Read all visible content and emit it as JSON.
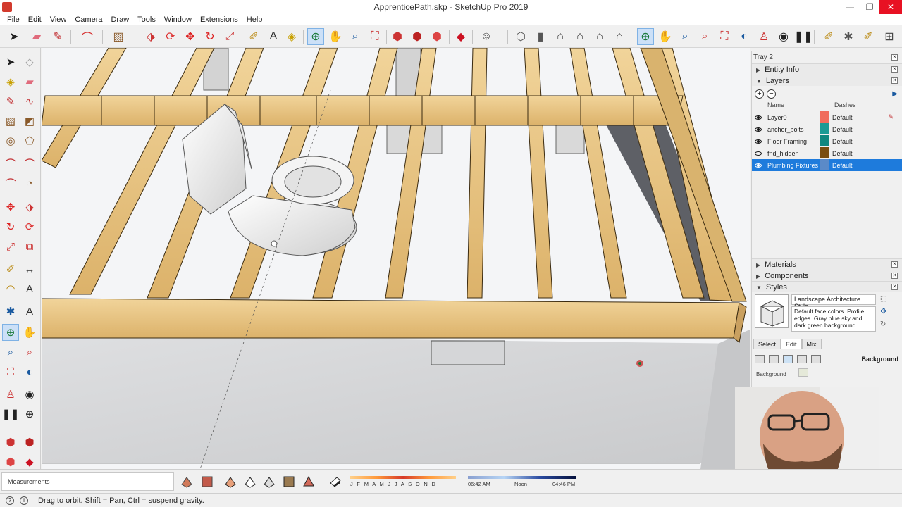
{
  "window": {
    "title": "ApprenticePath.skp - SketchUp Pro 2019",
    "controls": [
      "minimize",
      "maximize",
      "close"
    ]
  },
  "menu": [
    "File",
    "Edit",
    "View",
    "Camera",
    "Draw",
    "Tools",
    "Window",
    "Extensions",
    "Help"
  ],
  "toolbar": {
    "tools": [
      {
        "name": "select-icon",
        "glyph": "➤",
        "color": "#222222"
      },
      {
        "name": "eraser-icon",
        "glyph": "▰",
        "color": "#e06b7c"
      },
      {
        "name": "line-icon",
        "glyph": "✎",
        "color": "#c0282b"
      },
      {
        "name": "arc-icon",
        "glyph": "⌒",
        "color": "#d52a2a"
      },
      {
        "name": "rectangle-icon",
        "glyph": "▧",
        "color": "#8a5a2a"
      },
      {
        "name": "push-pull-icon",
        "glyph": "⬗",
        "color": "#c33"
      },
      {
        "name": "follow-me-icon",
        "glyph": "⟳",
        "color": "#d33"
      },
      {
        "name": "move-icon",
        "glyph": "✥",
        "color": "#d22"
      },
      {
        "name": "rotate-icon",
        "glyph": "↻",
        "color": "#d22"
      },
      {
        "name": "scale-icon",
        "glyph": "⤢",
        "color": "#c33"
      },
      {
        "name": "tape-measure-icon",
        "glyph": "✐",
        "color": "#b8860b"
      },
      {
        "name": "text-icon",
        "glyph": "A",
        "color": "#333"
      },
      {
        "name": "paint-bucket-icon",
        "glyph": "◈",
        "color": "#c8a000"
      },
      {
        "name": "orbit-icon",
        "glyph": "⊕",
        "color": "#1a7a3a",
        "active": true
      },
      {
        "name": "pan-icon",
        "glyph": "✋",
        "color": "#c8a060"
      },
      {
        "name": "zoom-icon",
        "glyph": "⌕",
        "color": "#1a5aa0"
      },
      {
        "name": "zoom-extents-icon",
        "glyph": "⛶",
        "color": "#c33"
      },
      {
        "name": "warehouse-icon",
        "glyph": "⬢",
        "color": "#c33"
      },
      {
        "name": "share-model-icon",
        "glyph": "⬢",
        "color": "#b22"
      },
      {
        "name": "extension-warehouse-icon",
        "glyph": "⬢",
        "color": "#d44"
      },
      {
        "name": "ruby-icon",
        "glyph": "◆",
        "color": "#c12"
      },
      {
        "name": "account-icon",
        "glyph": "☺",
        "color": "#444"
      },
      {
        "name": "iso-view-icon",
        "glyph": "⬡",
        "color": "#555"
      },
      {
        "name": "top-view-icon",
        "glyph": "▮",
        "color": "#555"
      },
      {
        "name": "front-view-icon",
        "glyph": "⌂",
        "color": "#333"
      },
      {
        "name": "right-view-icon",
        "glyph": "⌂",
        "color": "#333"
      },
      {
        "name": "back-view-icon",
        "glyph": "⌂",
        "color": "#333"
      },
      {
        "name": "left-view-icon",
        "glyph": "⌂",
        "color": "#333"
      },
      {
        "name": "orbit-2-icon",
        "glyph": "⊕",
        "color": "#1a7a3a",
        "active": true
      },
      {
        "name": "pan-2-icon",
        "glyph": "✋",
        "color": "#c8a060"
      },
      {
        "name": "zoom-2-icon",
        "glyph": "⌕",
        "color": "#1a5aa0"
      },
      {
        "name": "zoom-window-icon",
        "glyph": "⌕",
        "color": "#c33"
      },
      {
        "name": "zoom-extents-2-icon",
        "glyph": "⛶",
        "color": "#c33"
      },
      {
        "name": "previous-view-icon",
        "glyph": "◐",
        "color": "#1a5aa0"
      },
      {
        "name": "position-camera-icon",
        "glyph": "♙",
        "color": "#c33"
      },
      {
        "name": "look-around-icon",
        "glyph": "◉",
        "color": "#222"
      },
      {
        "name": "walk-icon",
        "glyph": "❚❚",
        "color": "#222"
      },
      {
        "name": "section-plane-icon",
        "glyph": "✐",
        "color": "#b8860b"
      },
      {
        "name": "axes-icon",
        "glyph": "✱",
        "color": "#555"
      },
      {
        "name": "section-fill-icon",
        "glyph": "✐",
        "color": "#b8860b"
      },
      {
        "name": "more-tools-icon",
        "glyph": "⊞",
        "color": "#444"
      }
    ]
  },
  "tray": {
    "title": "Tray 2",
    "panels": {
      "entity_info": "Entity Info",
      "layers": "Layers",
      "materials": "Materials",
      "components": "Components",
      "styles": "Styles"
    },
    "layers_header": {
      "name": "Name",
      "dashes": "Dashes"
    },
    "layers": [
      {
        "name": "Layer0",
        "color": "#f06c5c",
        "dashes": "Default",
        "visible": true
      },
      {
        "name": "anchor_bolts",
        "color": "#1a9a94",
        "dashes": "Default",
        "visible": true
      },
      {
        "name": "Floor Framing",
        "color": "#10877f",
        "dashes": "Default",
        "visible": true
      },
      {
        "name": "fnd_hidden",
        "color": "#7a4d10",
        "dashes": "Default",
        "visible": false
      },
      {
        "name": "Plumbing Fixtures",
        "color": "#5b8ac8",
        "dashes": "Default",
        "visible": true,
        "selected": true
      }
    ],
    "style": {
      "name": "Landscape Architecture Style",
      "description": "Default face colors. Profile edges. Gray blue sky and dark green background.",
      "tabs": [
        "Select",
        "Edit",
        "Mix"
      ],
      "active_tab": "Edit",
      "section_label": "Background",
      "field_label": "Background"
    }
  },
  "bottom": {
    "measurements_label": "Measurements",
    "months": "J F M A M J J A S O N D",
    "time_start": "06:42 AM",
    "time_mid": "Noon",
    "time_end": "04:46 PM"
  },
  "status": {
    "text": "Drag to orbit. Shift = Pan, Ctrl = suspend gravity."
  },
  "colors": {
    "lumber": "#e8c584",
    "concrete": "#d7d8da",
    "selection": "#1e7bdc"
  }
}
